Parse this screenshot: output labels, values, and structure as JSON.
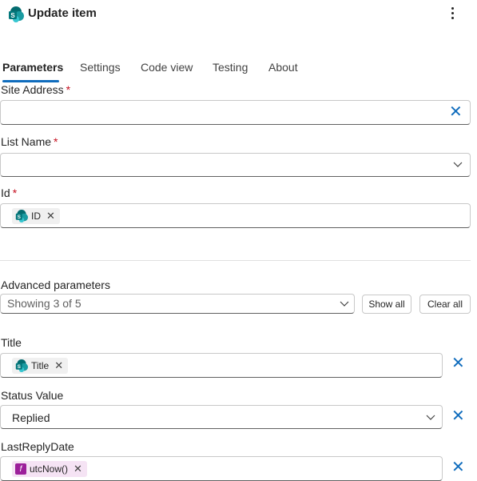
{
  "header": {
    "title": "Update item",
    "app_icon": "sharepoint-icon",
    "more_icon": "more-vertical-icon"
  },
  "tabs": [
    {
      "label": "Parameters",
      "active": true
    },
    {
      "label": "Settings",
      "active": false
    },
    {
      "label": "Code view",
      "active": false
    },
    {
      "label": "Testing",
      "active": false
    },
    {
      "label": "About",
      "active": false
    }
  ],
  "fields": {
    "site_address": {
      "label": "Site Address",
      "required_mark": "*",
      "value": ""
    },
    "list_name": {
      "label": "List Name",
      "required_mark": "*",
      "value": ""
    },
    "id": {
      "label": "Id",
      "required_mark": "*",
      "token": "ID"
    }
  },
  "advanced": {
    "label": "Advanced parameters",
    "showing": "Showing 3 of 5",
    "show_all": "Show all",
    "clear_all": "Clear all"
  },
  "params": {
    "title": {
      "label": "Title",
      "token": "Title"
    },
    "status_value": {
      "label": "Status Value",
      "value": "Replied"
    },
    "last_reply_date": {
      "label": "LastReplyDate",
      "token": "utcNow()"
    }
  },
  "colors": {
    "accent": "#0f6cbd",
    "required": "#c50f1f",
    "sharepoint": "#038387",
    "expression": "#9c1f9a"
  }
}
